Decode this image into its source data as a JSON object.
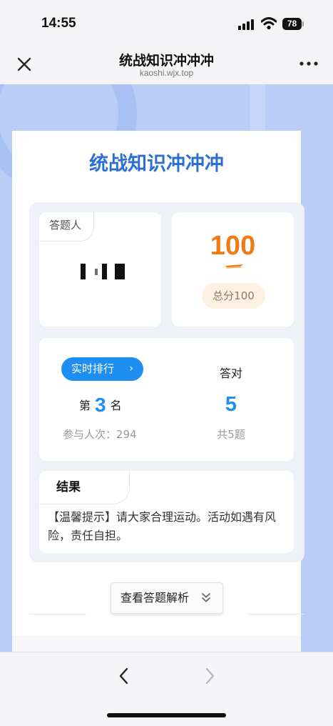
{
  "status_bar": {
    "time": "14:55",
    "battery": "78",
    "icons": [
      "signal-icon",
      "wifi-icon",
      "battery-icon"
    ]
  },
  "nav": {
    "title": "统战知识冲冲冲",
    "domain": "kaoshi.wjx.top",
    "close_icon": "close-icon",
    "more_icon": "more-icon"
  },
  "quiz": {
    "title": "统战知识冲冲冲",
    "respondent_label": "答题人",
    "score": "100",
    "total_score": "总分100",
    "rank_button": "实时排行",
    "rank_prefix": "第",
    "rank": "3",
    "rank_suffix": "名",
    "participants": "参与人次：294",
    "correct_label": "答对",
    "correct_count": "5",
    "total_questions": "共5题",
    "result_label": "结果",
    "result_text": "【温馨提示】请大家合理运动。活动如遇有风险，责任自担。",
    "analysis_button": "查看答题解析"
  },
  "colors": {
    "title_blue": "#2b6fd3",
    "accent_blue": "#1e8ff0",
    "score_orange": "#ee7b16",
    "background_blue": "#b9cdf7"
  },
  "toolbar": {
    "back_icon": "chevron-left-icon",
    "forward_icon": "chevron-right-icon"
  }
}
